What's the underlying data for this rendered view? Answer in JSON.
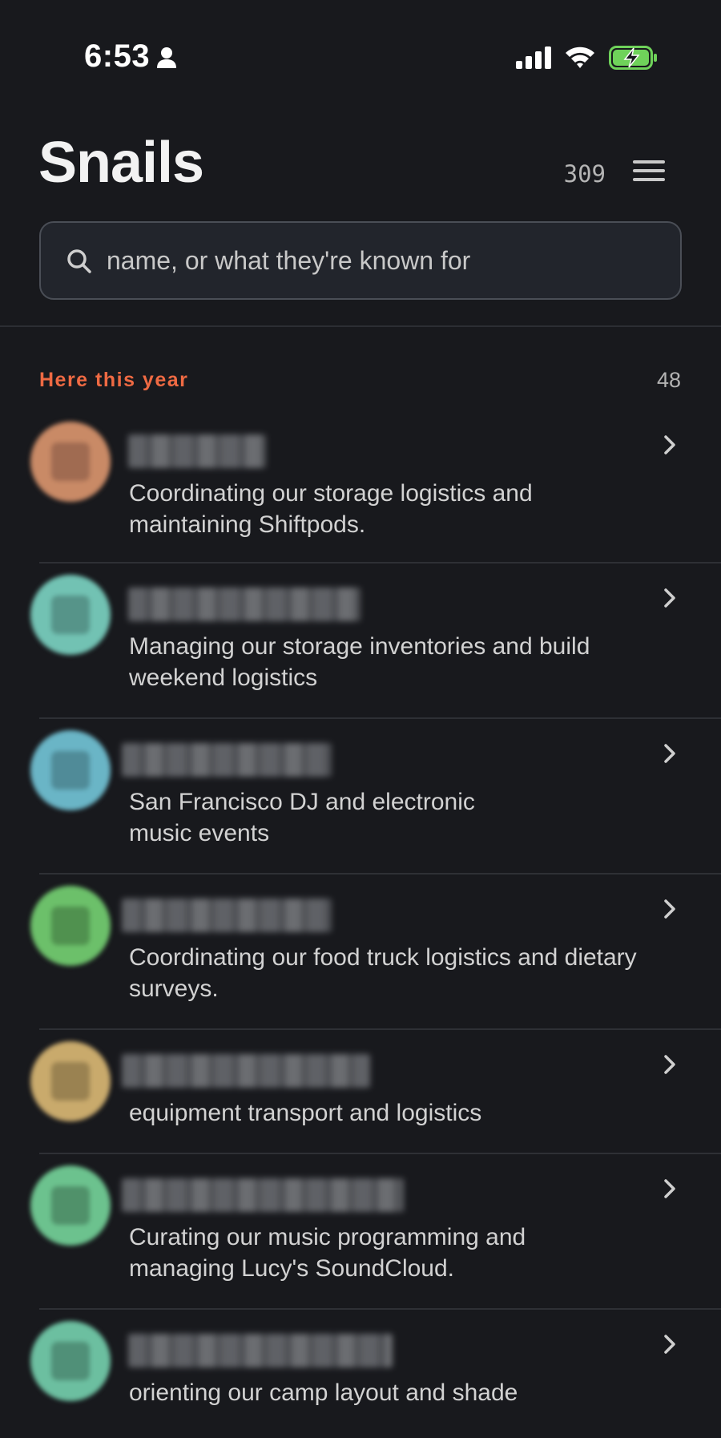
{
  "status_bar": {
    "time": "6:53"
  },
  "header": {
    "title": "Snails",
    "count": "309"
  },
  "search": {
    "placeholder": "name, or what they're known for"
  },
  "section": {
    "title": "Here this year",
    "count": "48"
  },
  "members": [
    {
      "description": "Coordinating our storage logistics and maintaining Shiftpods.",
      "color": "#c98a66"
    },
    {
      "description": "Managing our storage inventories and build weekend logistics",
      "color": "#72c2b3"
    },
    {
      "description": "San Francisco DJ and electronic music events",
      "color": "#6ab5c6"
    },
    {
      "description": "Coordinating our food truck logistics and dietary surveys.",
      "color": "#6cc06a"
    },
    {
      "description": "equipment transport and logistics",
      "color": "#c9aa6c"
    },
    {
      "description": "Curating our music programming and managing Lucy's SoundCloud.",
      "color": "#6cc28e"
    },
    {
      "description": "orienting our camp layout and shade",
      "color": "#6cbfa0"
    }
  ],
  "colors": {
    "background": "#18191d",
    "accent": "#ef6a43",
    "battery": "#6fd25a"
  },
  "icons": [
    "person-icon",
    "signal-icon",
    "wifi-icon",
    "battery-charging-icon",
    "menu-icon",
    "search-icon",
    "chevron-right-icon"
  ]
}
